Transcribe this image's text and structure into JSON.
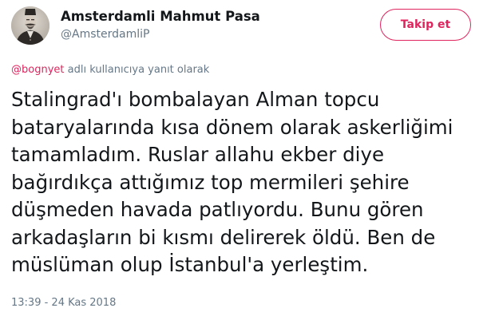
{
  "author": {
    "name": "Amsterdamli Mahmut Pasa",
    "handle": "@AmsterdamliP"
  },
  "follow_button": {
    "label": "Takip et"
  },
  "reply_context": {
    "mention": "@bognyet",
    "text": " adlı kullanıcıya yanıt olarak"
  },
  "tweet": {
    "lines": [
      "Stalingrad'ı bombalayan Alman topcu",
      "bataryalarında kısa dönem olarak askerliğimi",
      "tamamladım. Ruslar allahu ekber diye",
      "bağırdıkça attığımız top mermileri şehire",
      "düşmeden havada patlıyordu. Bunu gören",
      "arkadaşların bi kısmı delirerek öldü. Ben de",
      "müslüman olup İstanbul'a yerleştim."
    ],
    "timestamp": "13:39 - 24 Kas 2018"
  },
  "colors": {
    "accent": "#e0245e",
    "muted": "#657786",
    "text": "#14171a"
  },
  "icons": {
    "avatar": "avatar-portrait"
  }
}
